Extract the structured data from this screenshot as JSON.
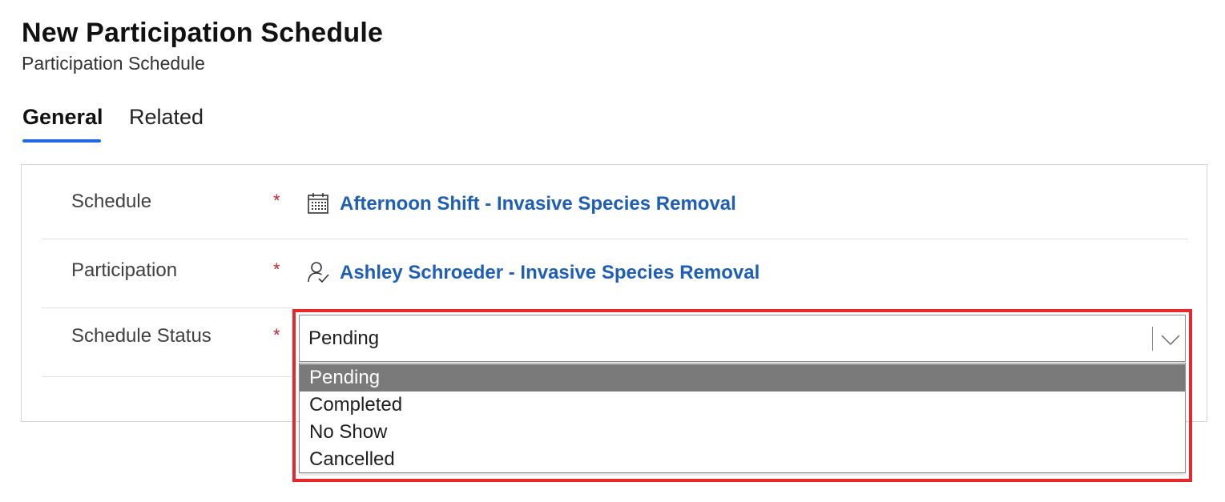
{
  "header": {
    "title": "New Participation Schedule",
    "subtitle": "Participation Schedule"
  },
  "tabs": [
    {
      "label": "General",
      "active": true
    },
    {
      "label": "Related",
      "active": false
    }
  ],
  "form": {
    "fields": [
      {
        "label": "Schedule",
        "required_mark": "*",
        "value": "Afternoon Shift - Invasive Species Removal",
        "icon": "calendar-icon"
      },
      {
        "label": "Participation",
        "required_mark": "*",
        "value": "Ashley Schroeder - Invasive Species Removal",
        "icon": "person-check-icon"
      },
      {
        "label": "Schedule Status",
        "required_mark": "*",
        "value": "Pending",
        "icon": "chevron-down-icon"
      }
    ],
    "status_options": [
      "Pending",
      "Completed",
      "No Show",
      "Cancelled"
    ],
    "selected_option": "Pending"
  },
  "colors": {
    "accent": "#2266e3",
    "link": "#1e5fb5",
    "required": "#c4262e",
    "highlight": "#e8262c",
    "selected_option_bg": "#7a7a7a"
  }
}
